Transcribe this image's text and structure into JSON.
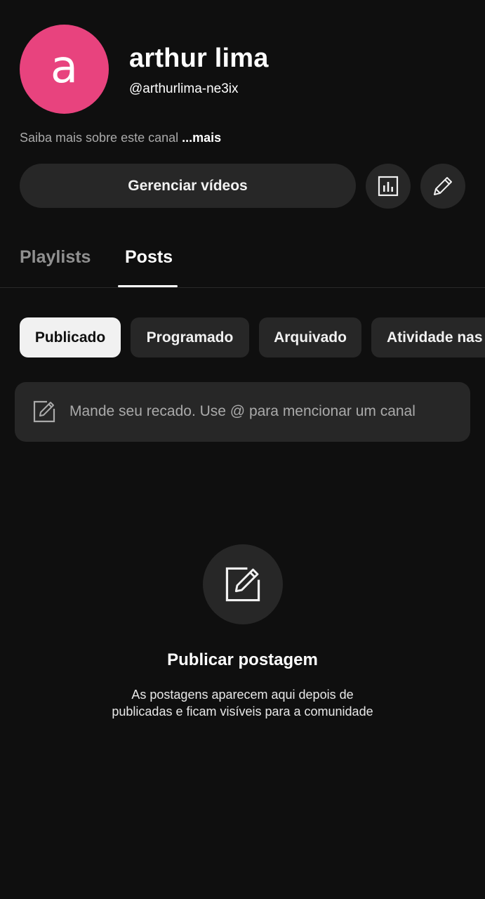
{
  "channel": {
    "avatar_letter": "a",
    "avatar_color": "#e8437e",
    "name": "arthur lima",
    "handle": "@arthurlima-ne3ix",
    "about_text": "Saiba mais sobre este canal",
    "about_more": "...mais"
  },
  "actions": {
    "manage_label": "Gerenciar vídeos",
    "analytics_icon": "bar-chart-icon",
    "edit_icon": "pencil-icon"
  },
  "tabs": [
    {
      "label": "Playlists",
      "active": false
    },
    {
      "label": "Posts",
      "active": true
    }
  ],
  "chips": [
    {
      "label": "Publicado",
      "active": true
    },
    {
      "label": "Programado",
      "active": false
    },
    {
      "label": "Arquivado",
      "active": false
    },
    {
      "label": "Atividade nas",
      "active": false
    }
  ],
  "compose": {
    "placeholder": "Mande seu recado. Use @ para mencionar um canal",
    "icon": "edit-square-icon"
  },
  "empty_state": {
    "icon": "edit-square-icon",
    "title": "Publicar postagem",
    "description_line1": "As postagens aparecem aqui depois de",
    "description_line2": "publicadas e ficam visíveis para a comunidade"
  },
  "colors": {
    "background": "#0f0f0f",
    "surface": "#272727",
    "text_primary": "#f1f1f1",
    "text_secondary": "#aaaaaa"
  }
}
